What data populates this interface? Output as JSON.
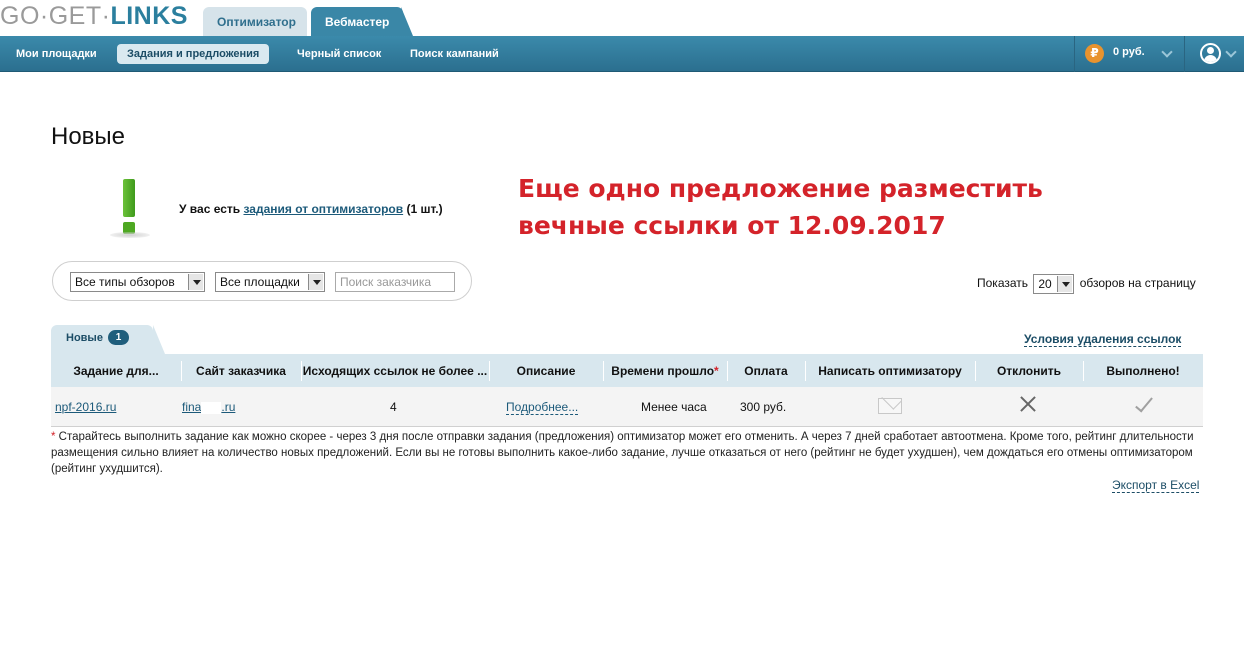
{
  "logo": {
    "part1": "GO·GET·",
    "part2": "LINKS"
  },
  "role_tabs": [
    {
      "label": "Оптимизатор"
    },
    {
      "label": "Вебмастер"
    }
  ],
  "nav": {
    "items": [
      {
        "label": "Мои площадки"
      },
      {
        "label": "Задания и предложения"
      },
      {
        "label": "Черный список"
      },
      {
        "label": "Поиск кампаний"
      }
    ],
    "active": "Задания и предложения"
  },
  "balance": {
    "currency_symbol": "₽",
    "amount": "0 руб."
  },
  "page": {
    "title": "Новые"
  },
  "notice": {
    "prefix": "У вас есть ",
    "link": "задания от оптимизаторов",
    "suffix": " (1 шт.)"
  },
  "overlay": {
    "line1": "Еще одно предложение разместить",
    "line2": "вечные ссылки от 12.09.2017"
  },
  "filters": {
    "review_type": "Все типы обзоров",
    "sites": "Все площадки",
    "search_placeholder": "Поиск заказчика"
  },
  "per_page": {
    "prefix": "Показать",
    "value": "20",
    "suffix": "обзоров на страницу"
  },
  "table_tab": {
    "label": "Новые",
    "count": "1"
  },
  "terms_link": "Условия удаления ссылок",
  "table": {
    "columns": [
      "Задание для...",
      "Сайт заказчика",
      "Исходящих ссылок не более ...",
      "Описание",
      "Времени прошло",
      "Оплата",
      "Написать оптимизатору",
      "Отклонить",
      "Выполнено!"
    ],
    "rows": [
      {
        "task_for": "npf-2016.ru",
        "site_prefix": "fina",
        "site_suffix": ".ru",
        "max_links": "4",
        "description": "Подробнее...",
        "time_passed": "Менее часа",
        "payment": "300 руб."
      }
    ]
  },
  "footnote": {
    "star": "*",
    "text": " Старайтесь выполнить задание как можно скорее - через 3 дня после отправки задания (предложения) оптимизатор может его отменить. А через 7 дней сработает автоотмена. Кроме того, рейтинг длительности размещения сильно влияет на количество новых предложений. Если вы не готовы выполнить какое-либо задание, лучше отказаться от него (рейтинг не будет ухудшен), чем дождаться его отмены оптимизатором (рейтинг ухудшится)."
  },
  "export_link": "Экспорт в Excel",
  "colors": {
    "accent": "#3a87a7",
    "nav_dark": "#2b6f8f",
    "overlay_red": "#d4232a",
    "coin": "#e8932e"
  }
}
